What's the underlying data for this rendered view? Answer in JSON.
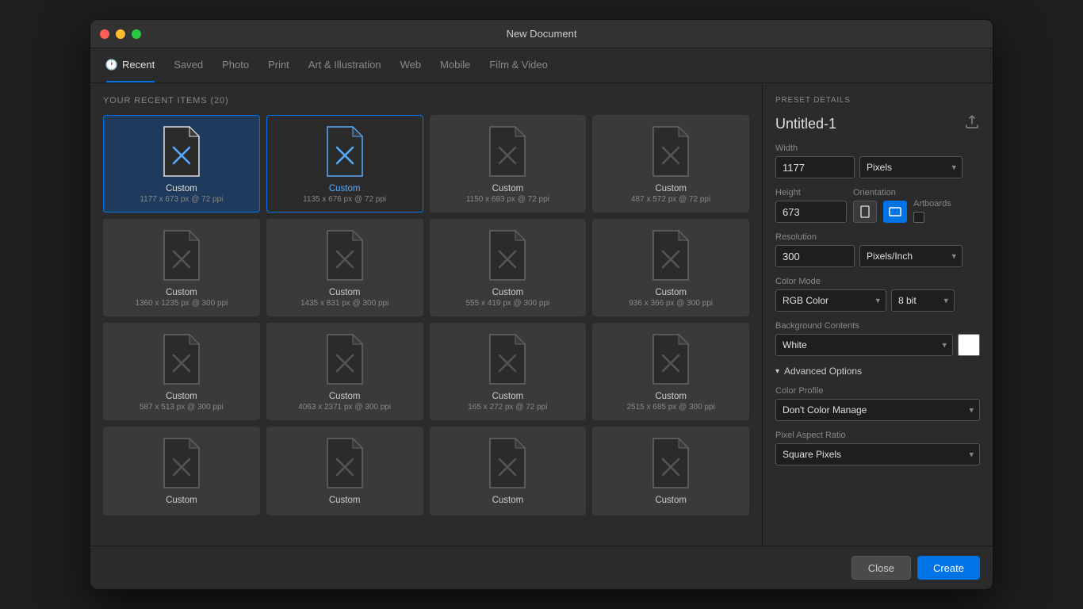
{
  "window": {
    "title": "New Document"
  },
  "tabs": [
    {
      "id": "recent",
      "label": "Recent",
      "active": true,
      "has_icon": true
    },
    {
      "id": "saved",
      "label": "Saved",
      "active": false,
      "has_icon": false
    },
    {
      "id": "photo",
      "label": "Photo",
      "active": false,
      "has_icon": false
    },
    {
      "id": "print",
      "label": "Print",
      "active": false,
      "has_icon": false
    },
    {
      "id": "art",
      "label": "Art & Illustration",
      "active": false,
      "has_icon": false
    },
    {
      "id": "web",
      "label": "Web",
      "active": false,
      "has_icon": false
    },
    {
      "id": "mobile",
      "label": "Mobile",
      "active": false,
      "has_icon": false
    },
    {
      "id": "film",
      "label": "Film & Video",
      "active": false,
      "has_icon": false
    }
  ],
  "recent_section": {
    "title": "YOUR RECENT ITEMS",
    "count": "(20)"
  },
  "items": [
    {
      "name": "Custom",
      "dims": "1177 x 673 px @ 72 ppi",
      "selected": true,
      "link": false
    },
    {
      "name": "Custom",
      "dims": "1135 x 676 px @ 72 ppi",
      "selected": false,
      "link": true
    },
    {
      "name": "Custom",
      "dims": "1150 x 683 px @ 72 ppi",
      "selected": false,
      "link": false
    },
    {
      "name": "Custom",
      "dims": "487 x 572 px @ 72 ppi",
      "selected": false,
      "link": false
    },
    {
      "name": "Custom",
      "dims": "1360 x 1235 px @ 300 ppi",
      "selected": false,
      "link": false
    },
    {
      "name": "Custom",
      "dims": "1435 x 831 px @ 300 ppi",
      "selected": false,
      "link": false
    },
    {
      "name": "Custom",
      "dims": "555 x 419 px @ 300 ppi",
      "selected": false,
      "link": false
    },
    {
      "name": "Custom",
      "dims": "936 x 366 px @ 300 ppi",
      "selected": false,
      "link": false
    },
    {
      "name": "Custom",
      "dims": "587 x 513 px @ 300 ppi",
      "selected": false,
      "link": false
    },
    {
      "name": "Custom",
      "dims": "4063 x 2371 px @ 300 ppi",
      "selected": false,
      "link": false
    },
    {
      "name": "Custom",
      "dims": "165 x 272 px @ 72 ppi",
      "selected": false,
      "link": false
    },
    {
      "name": "Custom",
      "dims": "2515 x 685 px @ 300 ppi",
      "selected": false,
      "link": false
    },
    {
      "name": "Custom",
      "dims": "",
      "selected": false,
      "link": false
    },
    {
      "name": "Custom",
      "dims": "",
      "selected": false,
      "link": false
    },
    {
      "name": "Custom",
      "dims": "",
      "selected": false,
      "link": false
    },
    {
      "name": "Custom",
      "dims": "",
      "selected": false,
      "link": false
    }
  ],
  "preset": {
    "label": "PRESET DETAILS",
    "name": "Untitled-1"
  },
  "fields": {
    "width_label": "Width",
    "width_value": "1177",
    "width_unit": "Pixels",
    "height_label": "Height",
    "height_value": "673",
    "orientation_label": "Orientation",
    "artboards_label": "Artboards",
    "resolution_label": "Resolution",
    "resolution_value": "300",
    "resolution_unit": "Pixels/Inch",
    "color_mode_label": "Color Mode",
    "color_mode_value": "RGB Color",
    "color_bit": "8 bit",
    "bg_contents_label": "Background Contents",
    "bg_contents_value": "White",
    "advanced_label": "Advanced Options",
    "color_profile_label": "Color Profile",
    "color_profile_value": "Don't Color Manage",
    "pixel_aspect_label": "Pixel Aspect Ratio",
    "pixel_aspect_value": "Square Pixels"
  },
  "buttons": {
    "close": "Close",
    "create": "Create"
  }
}
